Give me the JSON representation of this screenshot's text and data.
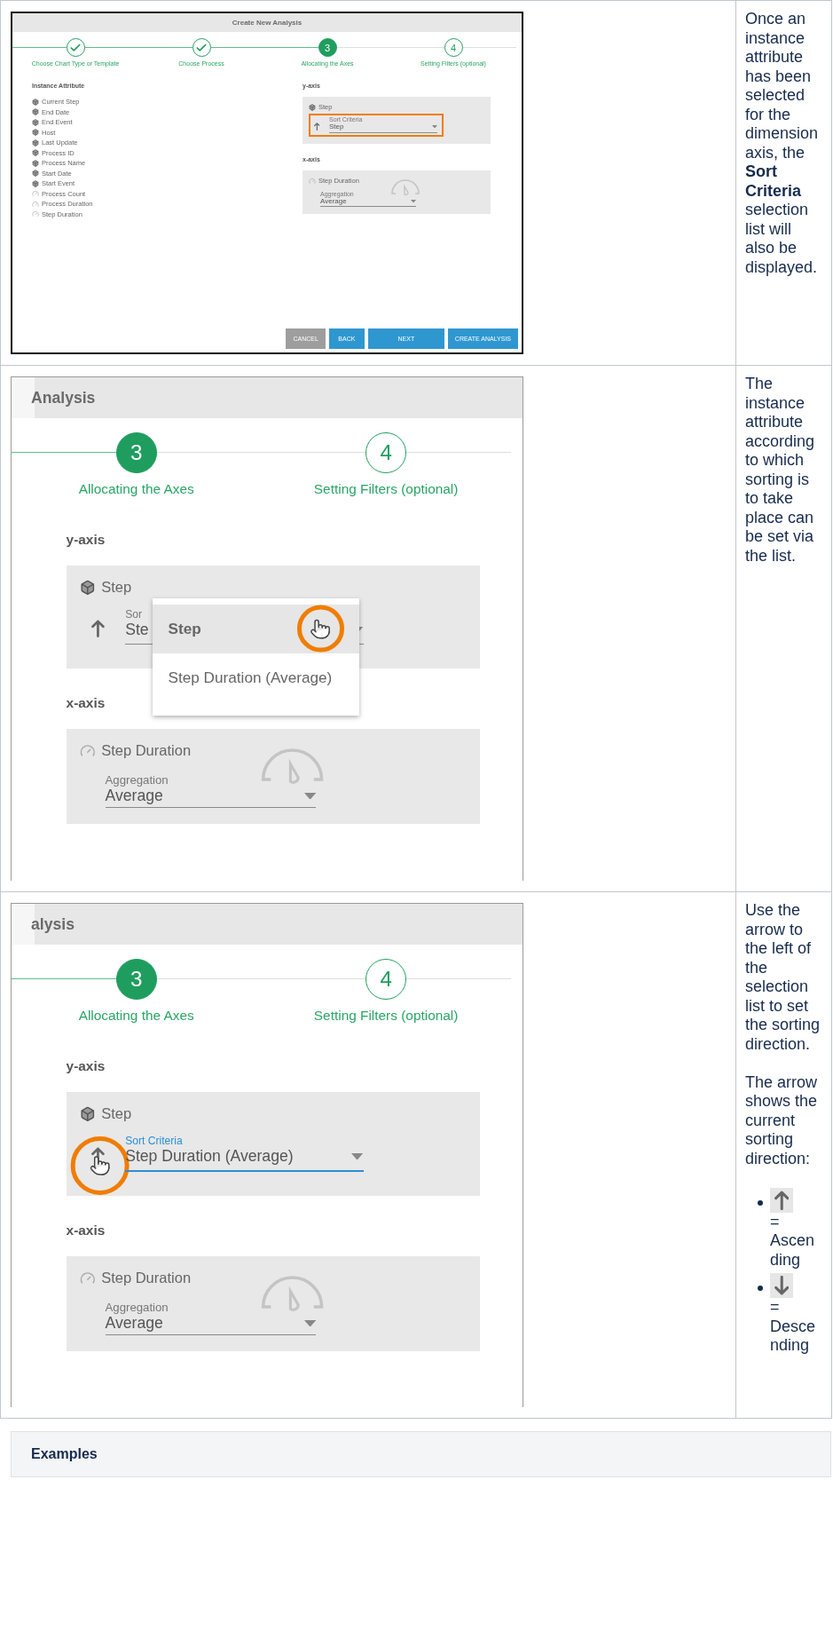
{
  "rows": [
    {
      "screenshot": {
        "kind": "dialog",
        "title": "Create New Analysis",
        "steps": [
          {
            "label": "Choose Chart Type or Template",
            "done": true,
            "active": false
          },
          {
            "label": "Choose Process",
            "done": true,
            "active": false
          },
          {
            "number": "3",
            "label": "Allocating the Axes",
            "done": false,
            "active": true
          },
          {
            "number": "4",
            "label": "Setting Filters (optional)",
            "done": false,
            "active": false
          }
        ],
        "attributes_heading": "Instance Attribute",
        "attributes": [
          {
            "label": "Current Step",
            "kind": "dimension"
          },
          {
            "label": "End Date",
            "kind": "dimension"
          },
          {
            "label": "End Event",
            "kind": "dimension"
          },
          {
            "label": "Host",
            "kind": "dimension"
          },
          {
            "label": "Last Update",
            "kind": "dimension"
          },
          {
            "label": "Process ID",
            "kind": "dimension"
          },
          {
            "label": "Process Name",
            "kind": "dimension"
          },
          {
            "label": "Start Date",
            "kind": "dimension"
          },
          {
            "label": "Start Event",
            "kind": "dimension"
          },
          {
            "label": "Process Count",
            "kind": "measure"
          },
          {
            "label": "Process Duration",
            "kind": "measure"
          },
          {
            "label": "Step Duration",
            "kind": "measure"
          }
        ],
        "y_axis": {
          "heading": "y-axis",
          "attribute": "Step",
          "ascending": true,
          "sort_label": "Sort Criteria",
          "sort_value": "Step",
          "focused": false,
          "field_highlighted": true,
          "arrow_highlighted": false
        },
        "x_axis": {
          "heading": "x-axis",
          "attribute": "Step Duration",
          "aggregation_label": "Aggregation",
          "aggregation_value": "Average"
        },
        "buttons": [
          {
            "label": "CANCEL",
            "kind": "neutral"
          },
          {
            "label": "BACK",
            "kind": "primary"
          },
          {
            "label": "NEXT",
            "kind": "wide"
          },
          {
            "label": "CREATE ANALYSIS",
            "kind": "primary"
          }
        ]
      },
      "description": {
        "paragraphs": [
          "Once an instance attribute has been selected for the dimension axis, the **Sort Criteria** selection list will also be displayed."
        ]
      }
    },
    {
      "screenshot": {
        "kind": "zoom",
        "title": "Analysis",
        "steps": [
          {
            "number": "3",
            "label": "Allocating the Axes",
            "done": false,
            "active": true
          },
          {
            "number": "4",
            "label": "Setting Filters (optional)",
            "done": false,
            "active": false
          }
        ],
        "y_axis": {
          "heading": "y-axis",
          "attribute": "Step",
          "ascending": true,
          "sort_label": "Sor",
          "sort_value": "Ste",
          "focused": false,
          "field_highlighted": false,
          "arrow_highlighted": false,
          "menu": [
            {
              "label": "Step",
              "selected": true,
              "highlighted": true
            },
            {
              "label": "Step Duration (Average)",
              "selected": false,
              "highlighted": false
            }
          ]
        },
        "x_axis": {
          "heading": "x-axis",
          "attribute": "Step Duration",
          "aggregation_label": "Aggregation",
          "aggregation_value": "Average"
        }
      },
      "description": {
        "paragraphs": [
          "The instance attribute according to which sorting is to take place can be set via the list."
        ]
      }
    },
    {
      "screenshot": {
        "kind": "zoom",
        "title": "alysis",
        "steps": [
          {
            "number": "3",
            "label": "Allocating the Axes",
            "done": false,
            "active": true
          },
          {
            "number": "4",
            "label": "Setting Filters (optional)",
            "done": false,
            "active": false
          }
        ],
        "y_axis": {
          "heading": "y-axis",
          "attribute": "Step",
          "ascending": true,
          "sort_label": "Sort Criteria",
          "sort_value": "Step Duration (Average)",
          "focused": true,
          "field_highlighted": false,
          "arrow_highlighted": true
        },
        "x_axis": {
          "heading": "x-axis",
          "attribute": "Step Duration",
          "aggregation_label": "Aggregation",
          "aggregation_value": "Average"
        }
      },
      "description": {
        "paragraphs": [
          "Use the arrow to the left of the selection list to set the sorting direction.",
          "The arrow shows the current sorting direction:"
        ],
        "legend": [
          {
            "ascending": true,
            "text": "= Ascending"
          },
          {
            "ascending": false,
            "text": "= Descending"
          }
        ]
      }
    }
  ],
  "examples": {
    "title": "Examples"
  }
}
